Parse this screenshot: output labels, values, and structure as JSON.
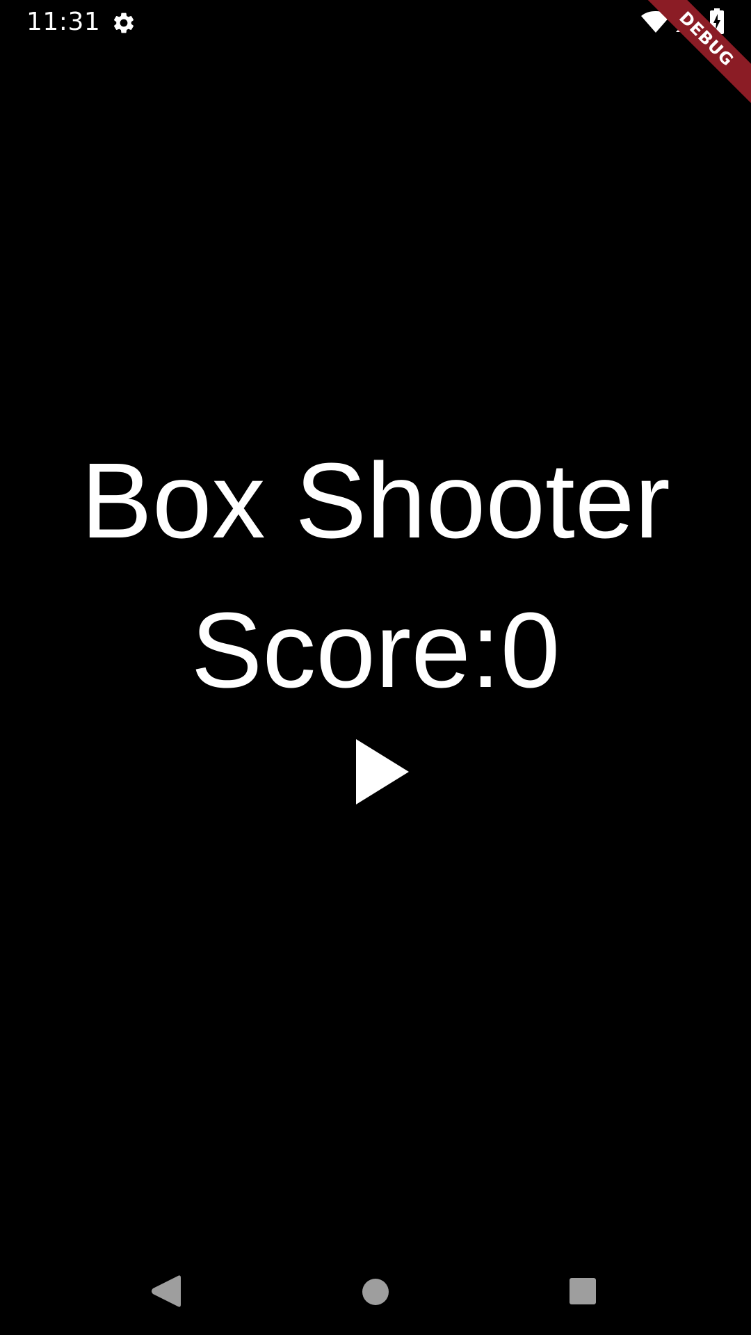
{
  "status_bar": {
    "time": "11:31",
    "icons": [
      "gear-icon",
      "wifi-icon",
      "signal-icon",
      "battery-charging-icon"
    ]
  },
  "debug_banner": {
    "label": "DEBUG",
    "color": "#8b1c25"
  },
  "game": {
    "title": "Box Shooter",
    "score_label": "Score:",
    "score_value": "0",
    "play_icon": "play-icon"
  },
  "nav_bar": {
    "icons": [
      "back-icon",
      "home-icon",
      "recents-icon"
    ]
  },
  "colors": {
    "background": "#000000",
    "foreground": "#ffffff",
    "nav_icon": "#9e9e9e"
  }
}
